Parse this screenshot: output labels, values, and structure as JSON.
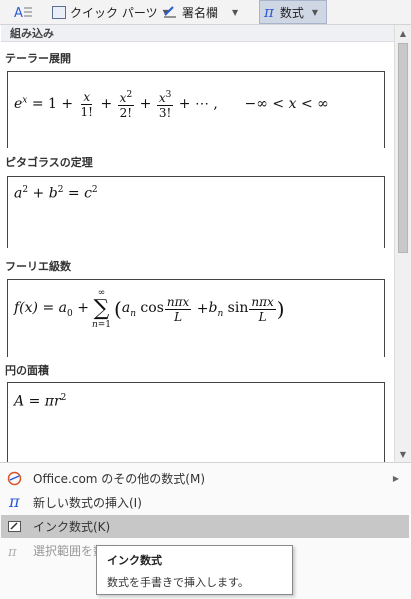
{
  "ribbon": {
    "quick_parts_label": "クイック パーツ",
    "signature_label": "署名欄",
    "equation_label": "数式",
    "pi_symbol": "π"
  },
  "gallery": {
    "section_title": "組み込み",
    "equations": [
      {
        "label": "テーラー展開"
      },
      {
        "label": "ピタゴラスの定理"
      },
      {
        "label": "フーリエ級数"
      },
      {
        "label": "円の面積"
      }
    ]
  },
  "menu": {
    "items": [
      {
        "label": "Office.com のその他の数式(M)"
      },
      {
        "label": "新しい数式の挿入(I)"
      },
      {
        "label": "インク数式(K)"
      },
      {
        "label": "選択範囲を数式"
      }
    ]
  },
  "tooltip": {
    "title": "インク数式",
    "description": "数式を手書きで挿入します。"
  },
  "colors": {
    "highlight": "#c7c7c7",
    "ribbon_active": "#cfd6e4",
    "pi_blue": "#2a5bd7"
  }
}
